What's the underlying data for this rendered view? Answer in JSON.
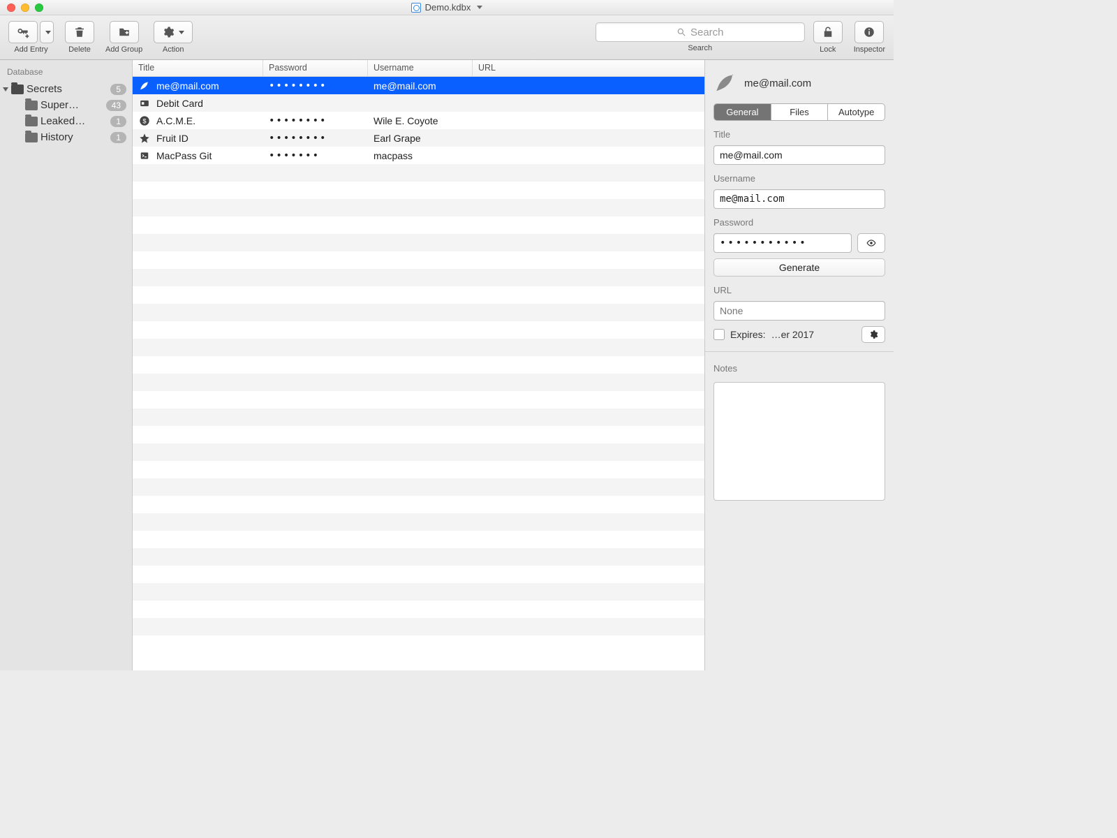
{
  "window": {
    "title": "Demo.kdbx"
  },
  "toolbar": {
    "addEntry": "Add Entry",
    "delete": "Delete",
    "addGroup": "Add Group",
    "action": "Action",
    "lock": "Lock",
    "inspector": "Inspector"
  },
  "search": {
    "placeholder": "Search",
    "label": "Search"
  },
  "sidebar": {
    "heading": "Database",
    "root": {
      "label": "Secrets",
      "count": "5"
    },
    "children": [
      {
        "label": "Super…",
        "count": "43"
      },
      {
        "label": "Leaked…",
        "count": "1"
      },
      {
        "label": "History",
        "count": "1"
      }
    ]
  },
  "table": {
    "columns": {
      "title": "Title",
      "password": "Password",
      "username": "Username",
      "url": "URL"
    },
    "rows": [
      {
        "icon": "feather",
        "title": "me@mail.com",
        "password": "••••••••",
        "username": "me@mail.com",
        "url": "",
        "selected": true
      },
      {
        "icon": "card",
        "title": "Debit Card",
        "password": "",
        "username": "",
        "url": ""
      },
      {
        "icon": "dollar",
        "title": "A.C.M.E.",
        "password": "••••••••",
        "username": "Wile E. Coyote",
        "url": ""
      },
      {
        "icon": "star",
        "title": "Fruit ID",
        "password": "••••••••",
        "username": "Earl Grape",
        "url": ""
      },
      {
        "icon": "terminal",
        "title": "MacPass Git",
        "password": "•••••••",
        "username": "macpass",
        "url": ""
      }
    ]
  },
  "inspector": {
    "heading": "me@mail.com",
    "tabs": {
      "general": "General",
      "files": "Files",
      "autotype": "Autotype"
    },
    "labels": {
      "title": "Title",
      "username": "Username",
      "password": "Password",
      "url": "URL",
      "notes": "Notes"
    },
    "values": {
      "title": "me@mail.com",
      "username": "me@mail.com",
      "password": "•••••••••••",
      "urlPlaceholder": "None"
    },
    "generate": "Generate",
    "expires": {
      "label": "Expires:",
      "value": "…er 2017"
    }
  }
}
